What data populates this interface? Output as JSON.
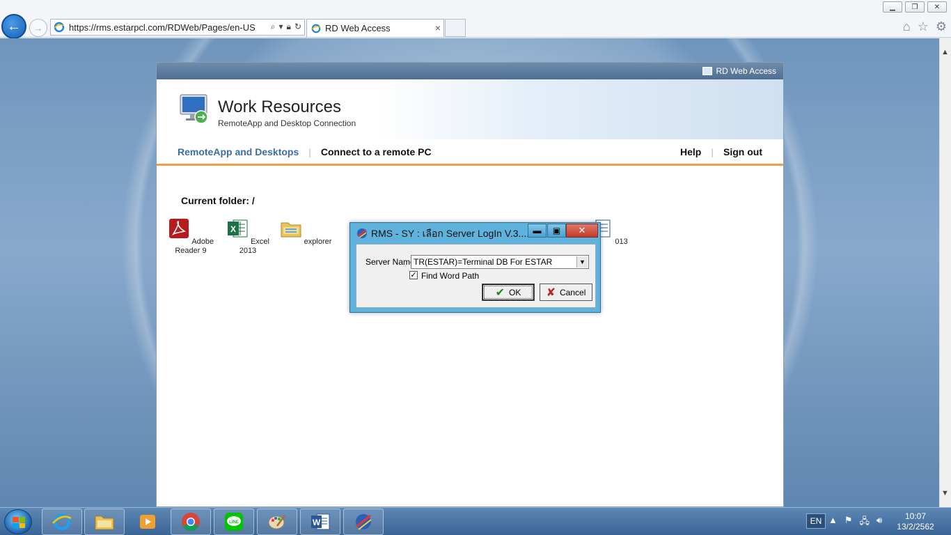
{
  "browser": {
    "url": "https://rms.estarpcl.com/RDWeb/Pages/en-US/Del",
    "tab_title": "RD Web Access",
    "tab_close": "×",
    "window_buttons": [
      "minimize-icon",
      "restore-icon",
      "close-icon"
    ]
  },
  "rdweb": {
    "topbar_label": "RD Web Access",
    "title": "Work Resources",
    "subtitle": "RemoteApp and Desktop Connection",
    "nav": {
      "remoteapp": "RemoteApp and Desktops",
      "connect": "Connect to a remote PC",
      "help": "Help",
      "signout": "Sign out",
      "separator": "|"
    },
    "current_folder": "Current folder: /",
    "apps": [
      {
        "label": "Adobe Reader 9",
        "icon": "adobe-reader-icon"
      },
      {
        "label": "Excel 2013",
        "icon": "excel-icon"
      },
      {
        "label": "explorer",
        "icon": "folder-icon"
      },
      {
        "label": "013",
        "icon": "word-icon"
      }
    ]
  },
  "dialog": {
    "title": "RMS - SY : เลือก Server LogIn V.3....",
    "min": "▬",
    "max": "▣",
    "close": "✕",
    "server_label": "Server Name",
    "server_value": "TR(ESTAR)=Terminal DB For ESTAR",
    "find_word_label": "Find Word Path",
    "find_word_checked": "✓",
    "ok_label": "OK",
    "cancel_label": "Cancel"
  },
  "taskbar": {
    "lang": "EN",
    "time": "10:07",
    "date": "13/2/2562",
    "pinned": [
      "ie-icon",
      "explorer-icon",
      "media-player-icon",
      "chrome-icon",
      "line-icon",
      "paint-icon",
      "word-icon",
      "rms-icon"
    ]
  }
}
